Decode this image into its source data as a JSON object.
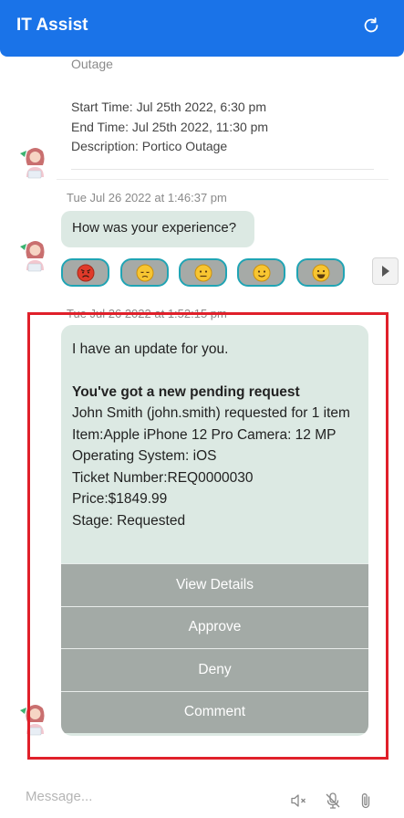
{
  "header": {
    "title": "IT Assist",
    "refresh_icon": "refresh-icon"
  },
  "outage": {
    "title": "Outage",
    "start_time": "Start Time: Jul 25th 2022, 6:30 pm",
    "end_time": "End Time: Jul 25th 2022, 11:30 pm",
    "description": "Description: Portico Outage"
  },
  "feedback": {
    "timestamp": "Tue Jul 26 2022 at 1:46:37 pm",
    "question": "How was your experience?",
    "emojis": [
      "😡",
      "😞",
      "😐",
      "🙂",
      "😀"
    ]
  },
  "update": {
    "timestamp": "Tue Jul 26 2022 at 1:52:15 pm",
    "intro": "I have an update for you.",
    "heading": "You've got a new pending request",
    "lines": [
      "John Smith (john.smith) requested for 1 item",
      "Item:Apple iPhone 12 Pro Camera: 12 MP",
      "Operating System: iOS",
      "Ticket Number:REQ0000030",
      "Price:$1849.99",
      "Stage: Requested"
    ],
    "actions": [
      "View Details",
      "Approve",
      "Deny",
      "Comment"
    ]
  },
  "composer": {
    "placeholder": "Message..."
  },
  "colors": {
    "header": "#1a73e8",
    "bubble": "#dce9e3",
    "button": "#a3aaa6",
    "highlight": "#e0202a",
    "emoji_border": "#20a4b4"
  }
}
